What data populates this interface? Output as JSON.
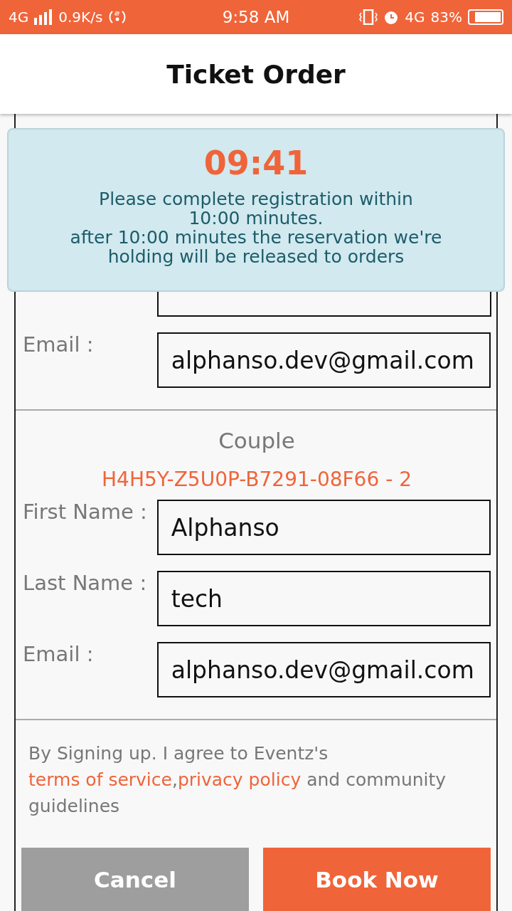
{
  "status_bar": {
    "network": "4G",
    "speed": "0.9K/s",
    "time": "9:58 AM",
    "data": "4G",
    "battery": "83%"
  },
  "header": {
    "title": "Ticket Order"
  },
  "timer": {
    "countdown": "09:41",
    "message_lines": [
      "Please complete registration within",
      "10:00 minutes.",
      "after 10:00 minutes the reservation we're",
      "holding will be released to orders"
    ]
  },
  "attendees": [
    {
      "cut_field_above": true,
      "fields": [
        {
          "label": "Email :",
          "value": "alphanso.dev@gmail.com"
        }
      ]
    },
    {
      "ticket_type": "Couple",
      "code": "H4H5Y-Z5U0P-B7291-08F66 - 2",
      "fields": [
        {
          "label": "First Name :",
          "value": "Alphanso"
        },
        {
          "label": "Last Name :",
          "value": "tech"
        },
        {
          "label": "Email :",
          "value": "alphanso.dev@gmail.com"
        }
      ]
    }
  ],
  "terms": [
    {
      "text": "By Signing up. I agree to Eventz's ",
      "link": false
    },
    {
      "text": "terms of service",
      "link": true
    },
    {
      "text": ",",
      "link": false
    },
    {
      "text": "privacy policy",
      "link": true
    },
    {
      "text": " and community guidelines",
      "link": false
    }
  ],
  "buttons": [
    {
      "label": "Cancel",
      "kind": "secondary"
    },
    {
      "label": "Book Now",
      "kind": "primary"
    }
  ]
}
